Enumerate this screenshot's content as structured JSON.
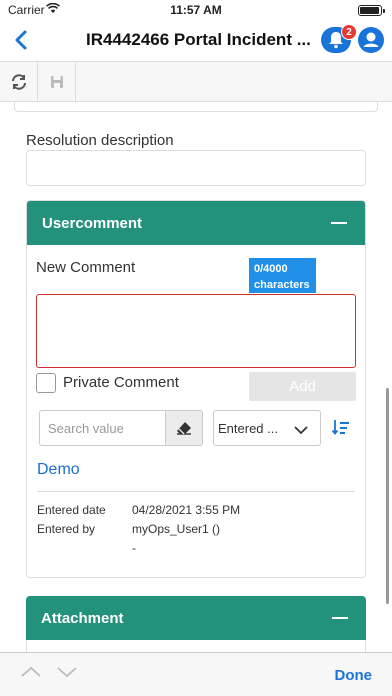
{
  "status_bar": {
    "carrier": "Carrier",
    "time": "11:57 AM"
  },
  "header": {
    "title": "IR4442466 Portal Incident ...",
    "notification_count": "2"
  },
  "form": {
    "resolution_label": "Resolution description"
  },
  "usercomment": {
    "title": "Usercomment",
    "new_comment_label": "New Comment",
    "char_count": "0/4000",
    "char_unit": "characters",
    "private_label": "Private Comment",
    "add_label": "Add",
    "search_placeholder": "Search value",
    "sort_value": "Entered ...",
    "entry": {
      "author_link": "Demo",
      "entered_date_label": "Entered date",
      "entered_date_value": "04/28/2021 3:55 PM",
      "entered_by_label": "Entered by",
      "entered_by_value": "myOps_User1 ()",
      "extra_value": "-"
    }
  },
  "attachment": {
    "title": "Attachment"
  },
  "keyboard_toolbar": {
    "done_label": "Done"
  },
  "colors": {
    "accent": "#23917c",
    "link": "#1a73d8",
    "badge": "#e53935",
    "error_border": "#d32f2f"
  }
}
